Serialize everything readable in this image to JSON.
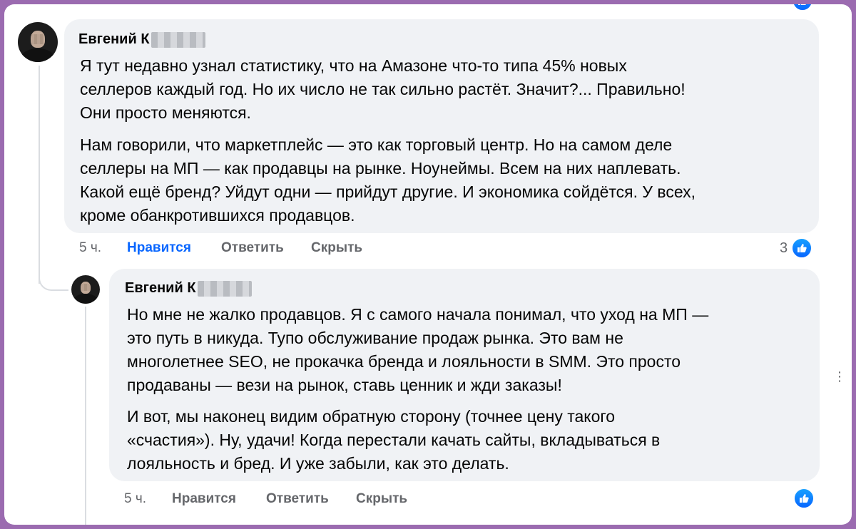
{
  "comments": [
    {
      "author": "Евгений К",
      "paragraphs": [
        "Я тут недавно узнал статистику, что на Амазоне что-то типа 45% новых\nселлеров каждый год. Но их число не так сильно растёт. Значит?... Правильно!\nОни просто меняются.",
        "Нам говорили, что маркетплейс — это как торговый центр. Но на самом деле\nселлеры на МП — как продавцы на рынке. Ноунеймы. Всем на них наплевать.\nКакой ещё бренд? Уйдут одни — прийдут другие. И экономика сойдётся. У всех,\nкроме обанкротившихся продавцов."
      ],
      "time": "5 ч.",
      "like_label": "Нравится",
      "reply_label": "Ответить",
      "hide_label": "Скрыть",
      "reaction_count": "3"
    },
    {
      "author": "Евгений К",
      "paragraphs": [
        "Но мне не жалко продавцов. Я с самого начала понимал, что уход на МП —\nэто путь в никуда. Тупо обслуживание продаж рынка. Это вам не\nмноголетнее SEO, не прокачка бренда и лояльности в SMM. Это просто\nпродаваны — вези на рынок, ставь ценник и жди заказы!",
        "И вот, мы наконец видим обратную сторону (точнее цену такого\n«счастия»). Ну, удачи! Когда перестали качать сайты, вкладываться в\nлояльность и бред. И уже забыли, как это делать."
      ],
      "time": "5 ч.",
      "like_label": "Нравится",
      "reply_label": "Ответить",
      "hide_label": "Скрыть"
    }
  ],
  "more_options": "⋮",
  "colors": {
    "frame_border": "#9b6bb0",
    "bubble": "#f0f2f5",
    "link_active": "#0866ff",
    "meta_text": "#65676b"
  },
  "icons": [
    "avatar",
    "like-icon",
    "more-options-icon"
  ]
}
